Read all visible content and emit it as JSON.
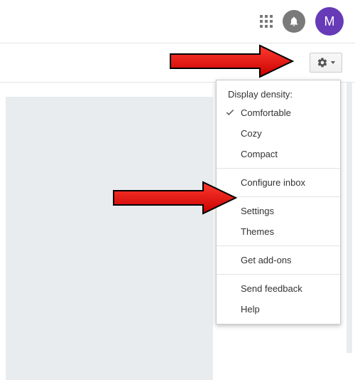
{
  "avatar": {
    "initial": "M"
  },
  "menu": {
    "header": "Display density:",
    "density": {
      "comfortable": "Comfortable",
      "cozy": "Cozy",
      "compact": "Compact"
    },
    "configure_inbox": "Configure inbox",
    "settings": "Settings",
    "themes": "Themes",
    "get_addons": "Get add-ons",
    "send_feedback": "Send feedback",
    "help": "Help"
  }
}
